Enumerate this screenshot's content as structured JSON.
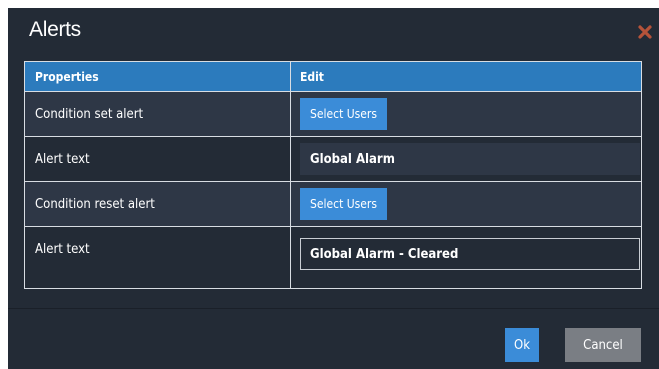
{
  "dialog": {
    "title": "Alerts",
    "close_icon": "close-icon",
    "colors": {
      "background": "#232b36",
      "header_row": "#2c7bbd",
      "accent_button": "#3b8cd8",
      "cancel_button": "#7a7e84",
      "close_icon": "#b5533a"
    }
  },
  "table": {
    "headers": {
      "properties": "Properties",
      "edit": "Edit"
    },
    "rows": [
      {
        "property": "Condition set alert",
        "type": "button",
        "button_label": "Select Users"
      },
      {
        "property": "Alert text",
        "type": "input",
        "value": "Global Alarm"
      },
      {
        "property": "Condition reset alert",
        "type": "button",
        "button_label": "Select Users"
      },
      {
        "property": "Alert text",
        "type": "input",
        "value": "Global Alarm - Cleared"
      }
    ]
  },
  "footer": {
    "ok_label": "Ok",
    "cancel_label": "Cancel"
  }
}
